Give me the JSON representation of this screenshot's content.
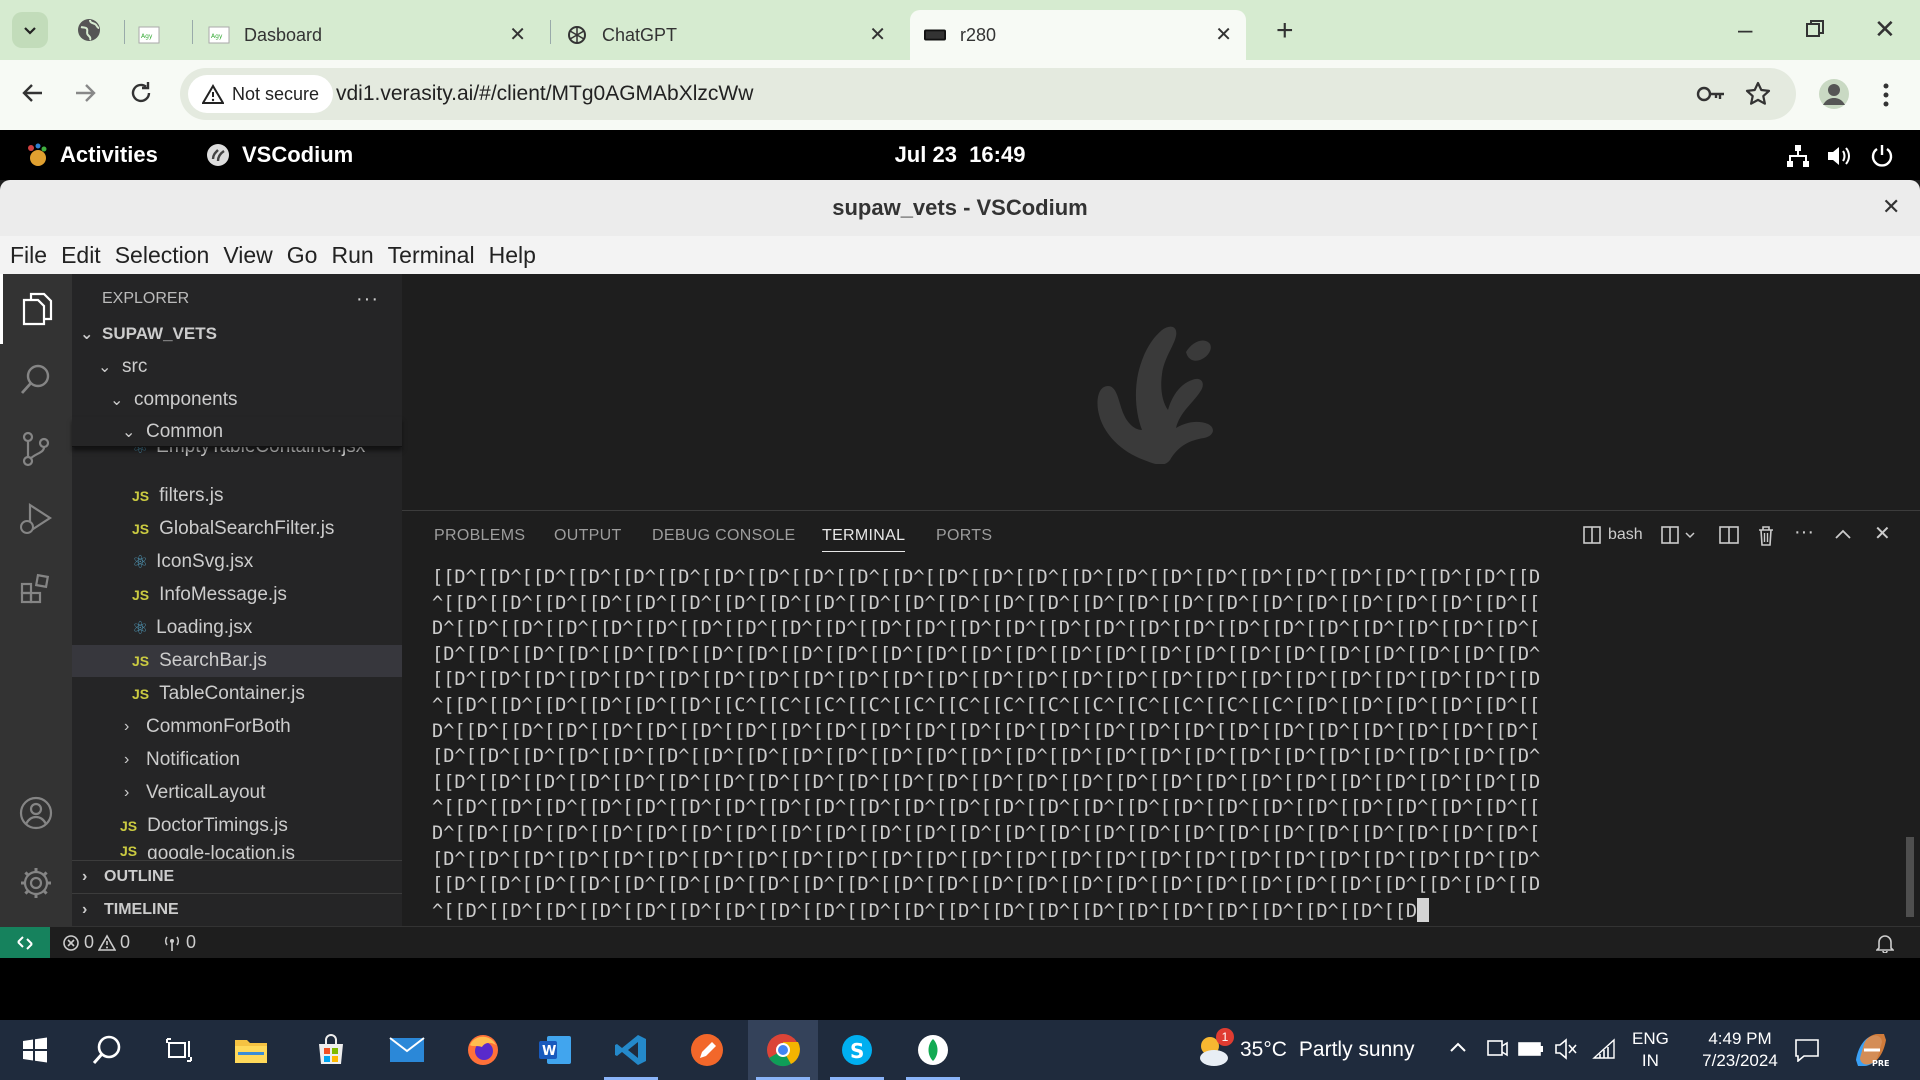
{
  "browser": {
    "tabs": [
      {
        "label": "",
        "favicon": "agency-favicon"
      },
      {
        "label": "Dasboard",
        "favicon": "agency-favicon"
      },
      {
        "label": "ChatGPT",
        "favicon": "openai-icon"
      },
      {
        "label": "r280",
        "favicon": "terminal-favicon"
      }
    ],
    "security_label": "Not secure",
    "url": "vdi1.verasity.ai/#/client/MTg0AGMAbXlzcWw"
  },
  "gnome": {
    "activities": "Activities",
    "app_name": "VSCodium",
    "clock": "Jul 23  16:49"
  },
  "window": {
    "title": "supaw_vets - VSCodium"
  },
  "menu": [
    "File",
    "Edit",
    "Selection",
    "View",
    "Go",
    "Run",
    "Terminal",
    "Help"
  ],
  "explorer": {
    "header": "EXPLORER",
    "root": "SUPAW_VETS",
    "tree": [
      {
        "label": "src",
        "type": "folder-open"
      },
      {
        "label": "components",
        "type": "folder-open"
      },
      {
        "label": "Common",
        "type": "folder-open"
      },
      {
        "label": "EmptyTableContainer.jsx",
        "type": "react"
      },
      {
        "label": "filters.js",
        "type": "js"
      },
      {
        "label": "GlobalSearchFilter.js",
        "type": "js"
      },
      {
        "label": "IconSvg.jsx",
        "type": "react"
      },
      {
        "label": "InfoMessage.js",
        "type": "js"
      },
      {
        "label": "Loading.jsx",
        "type": "react"
      },
      {
        "label": "SearchBar.js",
        "type": "js"
      },
      {
        "label": "TableContainer.js",
        "type": "js"
      },
      {
        "label": "CommonForBoth",
        "type": "folder"
      },
      {
        "label": "Notification",
        "type": "folder"
      },
      {
        "label": "VerticalLayout",
        "type": "folder"
      },
      {
        "label": "DoctorTimings.js",
        "type": "js"
      },
      {
        "label": "google-location.js",
        "type": "js"
      }
    ],
    "outline": "OUTLINE",
    "timeline": "TIMELINE"
  },
  "panel": {
    "tabs": [
      "PROBLEMS",
      "OUTPUT",
      "DEBUG CONSOLE",
      "TERMINAL",
      "PORTS"
    ],
    "active_tab": "TERMINAL",
    "shell": "bash",
    "terminal_lines": [
      "[[D^[[D^[[D^[[D^[[D^[[D^[[D^[[D^[[D^[[D^[[D^[[D^[[D^[[D^[[D^[[D^[[D^[[D^[[D^[[D^[[D^[[D^[[D^[[D^[[D",
      "^[[D^[[D^[[D^[[D^[[D^[[D^[[D^[[D^[[D^[[D^[[D^[[D^[[D^[[D^[[D^[[D^[[D^[[D^[[D^[[D^[[D^[[D^[[D^[[D^[[",
      "D^[[D^[[D^[[D^[[D^[[D^[[D^[[D^[[D^[[D^[[D^[[D^[[D^[[D^[[D^[[D^[[D^[[D^[[D^[[D^[[D^[[D^[[D^[[D^[[D^[",
      "[D^[[D^[[D^[[D^[[D^[[D^[[D^[[D^[[D^[[D^[[D^[[D^[[D^[[D^[[D^[[D^[[D^[[D^[[D^[[D^[[D^[[D^[[D^[[D^[[D^",
      "[[D^[[D^[[D^[[D^[[D^[[D^[[D^[[D^[[D^[[D^[[D^[[D^[[D^[[D^[[D^[[D^[[D^[[D^[[D^[[D^[[D^[[D^[[D^[[D^[[D",
      "^[[D^[[D^[[D^[[D^[[D^[[D^[[C^[[C^[[C^[[C^[[C^[[C^[[C^[[C^[[C^[[C^[[C^[[C^[[C^[[D^[[D^[[D^[[D^[[D^[[",
      "D^[[D^[[D^[[D^[[D^[[D^[[D^[[D^[[D^[[D^[[D^[[D^[[D^[[D^[[D^[[D^[[D^[[D^[[D^[[D^[[D^[[D^[[D^[[D^[[D^[",
      "[D^[[D^[[D^[[D^[[D^[[D^[[D^[[D^[[D^[[D^[[D^[[D^[[D^[[D^[[D^[[D^[[D^[[D^[[D^[[D^[[D^[[D^[[D^[[D^[[D^",
      "[[D^[[D^[[D^[[D^[[D^[[D^[[D^[[D^[[D^[[D^[[D^[[D^[[D^[[D^[[D^[[D^[[D^[[D^[[D^[[D^[[D^[[D^[[D^[[D^[[D",
      "^[[D^[[D^[[D^[[D^[[D^[[D^[[D^[[D^[[D^[[D^[[D^[[D^[[D^[[D^[[D^[[D^[[D^[[D^[[D^[[D^[[D^[[D^[[D^[[D^[[",
      "D^[[D^[[D^[[D^[[D^[[D^[[D^[[D^[[D^[[D^[[D^[[D^[[D^[[D^[[D^[[D^[[D^[[D^[[D^[[D^[[D^[[D^[[D^[[D^[[D^[",
      "[D^[[D^[[D^[[D^[[D^[[D^[[D^[[D^[[D^[[D^[[D^[[D^[[D^[[D^[[D^[[D^[[D^[[D^[[D^[[D^[[D^[[D^[[D^[[D^[[D^",
      "[[D^[[D^[[D^[[D^[[D^[[D^[[D^[[D^[[D^[[D^[[D^[[D^[[D^[[D^[[D^[[D^[[D^[[D^[[D^[[D^[[D^[[D^[[D^[[D^[[D",
      "^[[D^[[D^[[D^[[D^[[D^[[D^[[D^[[D^[[D^[[D^[[D^[[D^[[D^[[D^[[D^[[D^[[D^[[D^[[D^[[D^[[D^[[D"
    ]
  },
  "status": {
    "errors": "0",
    "warnings": "0",
    "ports": "0"
  },
  "taskbar": {
    "weather_temp": "35°C",
    "weather_desc": "Partly sunny",
    "weather_badge": "1",
    "lang_top": "ENG",
    "lang_bottom": "IN",
    "time": "4:49 PM",
    "date": "7/23/2024"
  },
  "colors": {
    "tabstrip": "#d6ebd0",
    "statusbar_remote": "#16825d",
    "taskbar": "#1f2b3d"
  }
}
